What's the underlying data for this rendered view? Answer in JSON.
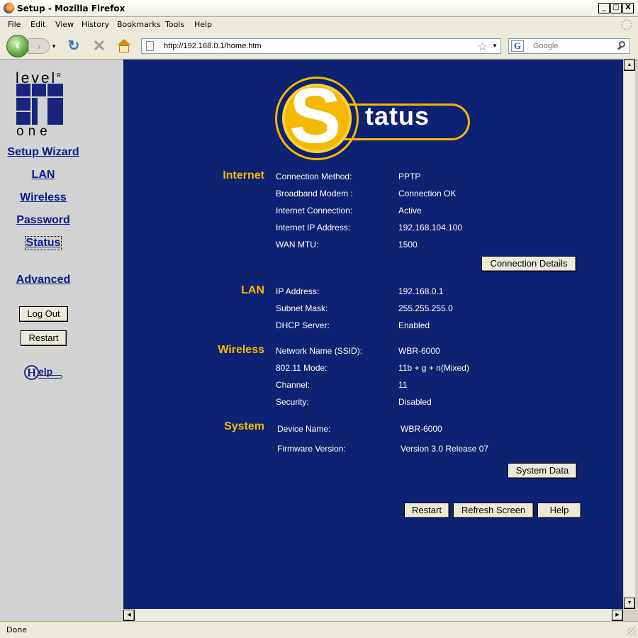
{
  "window": {
    "title": "Setup - Mozilla Firefox",
    "controls": [
      "_",
      "□",
      "X"
    ]
  },
  "menubar": [
    "File",
    "Edit",
    "View",
    "History",
    "Bookmarks",
    "Tools",
    "Help"
  ],
  "toolbar": {
    "url": "http://192.168.0.1/home.htm",
    "search_placeholder": "Google",
    "search_engine_letter": "G",
    "back_icon": "back-arrow-icon",
    "forward_icon": "forward-arrow-icon",
    "reload_icon": "reload-icon",
    "stop_icon": "stop-icon",
    "home_icon": "home-icon"
  },
  "sidebar": {
    "logo": {
      "top": "level",
      "reg": "R",
      "bottom": "one"
    },
    "links": [
      "Setup Wizard",
      "LAN",
      "Wireless",
      "Password",
      "Status",
      "Advanced"
    ],
    "active_link": "Status",
    "buttons": [
      "Log Out",
      "Restart"
    ],
    "help_logo": {
      "h": "H",
      "rest": "elp"
    }
  },
  "page": {
    "logo": {
      "letter": "S",
      "word": "tatus"
    },
    "sections": {
      "internet": {
        "title": "Internet",
        "rows": [
          {
            "label": "Connection Method:",
            "value": "PPTP"
          },
          {
            "label": "Broadband Modem :",
            "value": "Connection OK"
          },
          {
            "label": "Internet Connection:",
            "value": "Active"
          },
          {
            "label": "Internet IP Address:",
            "value": "192.168.104.100"
          },
          {
            "label": "WAN MTU:",
            "value": "1500"
          }
        ],
        "button": "Connection Details"
      },
      "lan": {
        "title": "LAN",
        "rows": [
          {
            "label": "IP Address:",
            "value": "192.168.0.1"
          },
          {
            "label": "Subnet Mask:",
            "value": "255.255.255.0"
          },
          {
            "label": "DHCP Server:",
            "value": "Enabled"
          }
        ]
      },
      "wireless": {
        "title": "Wireless",
        "rows": [
          {
            "label": "Network Name (SSID):",
            "value": "WBR-6000"
          },
          {
            "label": "802.11 Mode:",
            "value": "11b + g + n(Mixed)"
          },
          {
            "label": "Channel:",
            "value": "11"
          },
          {
            "label": "Security:",
            "value": "Disabled"
          }
        ]
      },
      "system": {
        "title": "System",
        "rows": [
          {
            "label": "Device Name:",
            "value": "WBR-6000"
          },
          {
            "label": "Firmware Version:",
            "value": "Version 3.0 Release 07"
          }
        ],
        "button": "System Data"
      }
    },
    "bottom_buttons": [
      "Restart",
      "Refresh Screen",
      "Help"
    ]
  },
  "colors": {
    "page_background": "#0d2272",
    "section_title": "#f5b800",
    "sidebar_background": "#d2d2d2",
    "link": "#0a1b8c"
  },
  "statusbar": {
    "text": "Done"
  }
}
